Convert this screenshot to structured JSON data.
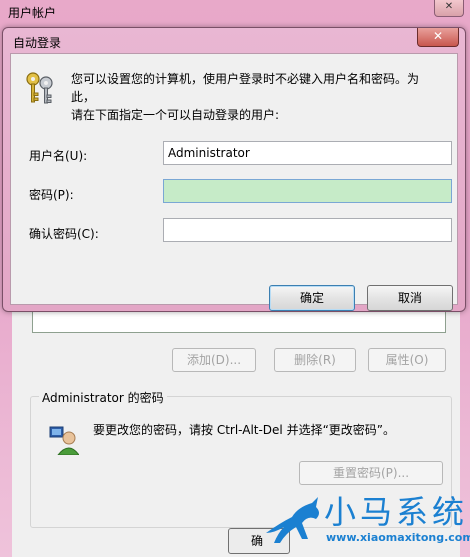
{
  "parent_window": {
    "title": "用户帐户",
    "buttons": {
      "add": "添加(D)...",
      "remove": "删除(R)",
      "properties": "属性(O)"
    },
    "password_group": {
      "title": "Administrator 的密码",
      "hint": "要更改您的密码，请按 Ctrl-Alt-Del 并选择“更改密码”。",
      "reset_button": "重置密码(P)..."
    },
    "ok_fragment": "确"
  },
  "dialog": {
    "title": "自动登录",
    "close_label": "✕",
    "intro_line1": "您可以设置您的计算机，使用户登录时不必键入用户名和密码。为此，",
    "intro_line2": "请在下面指定一个可以自动登录的用户:",
    "username_label": "用户名(U):",
    "username_value": "Administrator",
    "password_label": "密码(P):",
    "password_value": "",
    "confirm_label": "确认密码(C):",
    "confirm_value": "",
    "ok_button": "确定",
    "cancel_button": "取消"
  },
  "watermark": {
    "text": "小马系统",
    "url": "www.xiaomaxitong.com"
  },
  "colors": {
    "frame": "#e6a3c8",
    "active_field": "#c6ebc8",
    "watermark": "#1b80d1"
  }
}
